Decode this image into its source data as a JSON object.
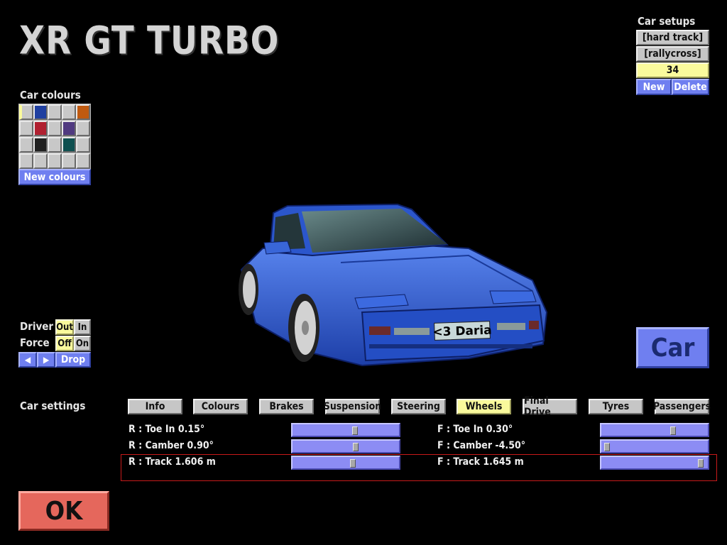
{
  "car_title": "XR GT TURBO",
  "car_colours": {
    "label": "Car colours",
    "swatches": [
      "#c8c8c8",
      "#1f3fa0",
      "#c8c8c8",
      "#c8c8c8",
      "#c05a10",
      "#c8c8c8",
      "#b02030",
      "#c8c8c8",
      "#503a80",
      "#c8c8c8",
      "#c8c8c8",
      "#202020",
      "#c8c8c8",
      "#0f5050",
      "#c8c8c8",
      "#c8c8c8",
      "#c8c8c8",
      "#c8c8c8",
      "#c8c8c8",
      "#c8c8c8"
    ],
    "selected_index": 0,
    "selected_color": "#fafa9c",
    "new_colours_label": "New colours"
  },
  "car_setups": {
    "label": "Car setups",
    "items": [
      "[hard track]",
      "[rallycross]"
    ],
    "selected_value": "34",
    "new_label": "New",
    "delete_label": "Delete"
  },
  "driver": {
    "driver_label": "Driver",
    "driver_options": [
      "Out",
      "In"
    ],
    "driver_selected": "Out",
    "force_label": "Force",
    "force_options": [
      "Off",
      "On"
    ],
    "force_selected": "Off",
    "prev_icon": "◀",
    "next_icon": "▶",
    "drop_label": "Drop"
  },
  "car_preview": {
    "plate_text": "<3 Daria",
    "body_color": "#2f5fd8"
  },
  "car_button_label": "Car",
  "car_settings": {
    "label": "Car settings",
    "tabs": [
      "Info",
      "Colours",
      "Brakes",
      "Suspension",
      "Steering",
      "Wheels",
      "Final Drive",
      "Tyres",
      "Passengers"
    ],
    "active_tab": "Wheels"
  },
  "wheels_settings": [
    {
      "label": "R : Toe In 0.15°",
      "position": 0.59
    },
    {
      "label": "F : Toe In 0.30°",
      "position": 0.68
    },
    {
      "label": "R : Camber 0.90°",
      "position": 0.6
    },
    {
      "label": "F : Camber -4.50°",
      "position": 0.03
    },
    {
      "label": "R : Track 1.606 m",
      "position": 0.57
    },
    {
      "label": "F : Track 1.645 m",
      "position": 0.96
    }
  ],
  "ok_label": "OK"
}
